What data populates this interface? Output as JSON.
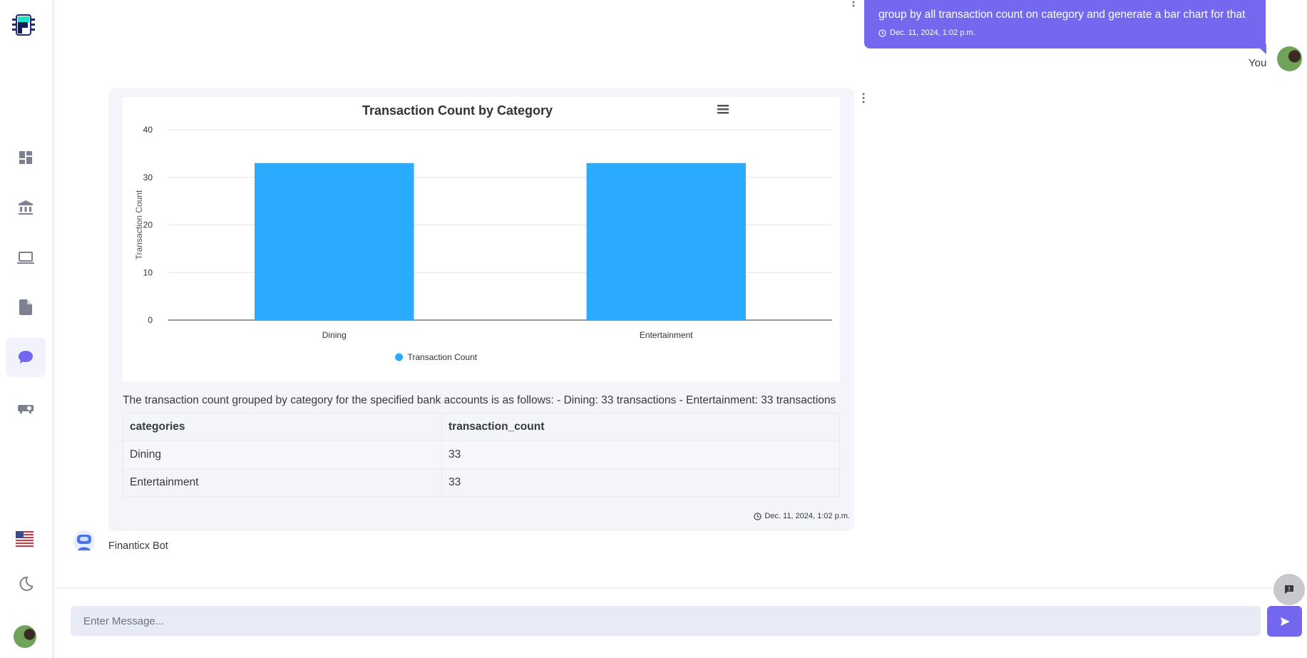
{
  "sidebar": {
    "items": [
      {
        "icon": "dashboard-icon"
      },
      {
        "icon": "bank-icon"
      },
      {
        "icon": "laptop-icon"
      },
      {
        "icon": "document-icon"
      },
      {
        "icon": "chat-icon",
        "active": true
      },
      {
        "icon": "projector-icon"
      }
    ],
    "language": "flag-us-icon",
    "theme": "moon-icon"
  },
  "user_message": {
    "text": "group by all transaction count on category and generate a bar chart for that",
    "timestamp": "Dec. 11, 2024, 1:02 p.m.",
    "author": "You"
  },
  "bot_message": {
    "description": "The transaction count grouped by category for the specified bank accounts is as follows: - Dining: 33 transactions - Entertainment: 33 transactions",
    "table": {
      "headers": [
        "categories",
        "transaction_count"
      ],
      "rows": [
        [
          "Dining",
          "33"
        ],
        [
          "Entertainment",
          "33"
        ]
      ]
    },
    "timestamp": "Dec. 11, 2024, 1:02 p.m.",
    "author": "Finanticx Bot"
  },
  "chart_data": {
    "type": "bar",
    "title": "Transaction Count by Category",
    "categories": [
      "Dining",
      "Entertainment"
    ],
    "series": [
      {
        "name": "Transaction Count",
        "values": [
          33,
          33
        ],
        "color": "#2aabfd"
      }
    ],
    "xlabel": "",
    "ylabel": "Transaction Count",
    "ylim": [
      0,
      40
    ],
    "yticks": [
      "0",
      "10",
      "20",
      "30",
      "40"
    ],
    "grid": true,
    "legend": "bottom-center"
  },
  "composer": {
    "placeholder": "Enter Message..."
  },
  "colors": {
    "accent": "#7367f0",
    "bar": "#2aabfd"
  }
}
